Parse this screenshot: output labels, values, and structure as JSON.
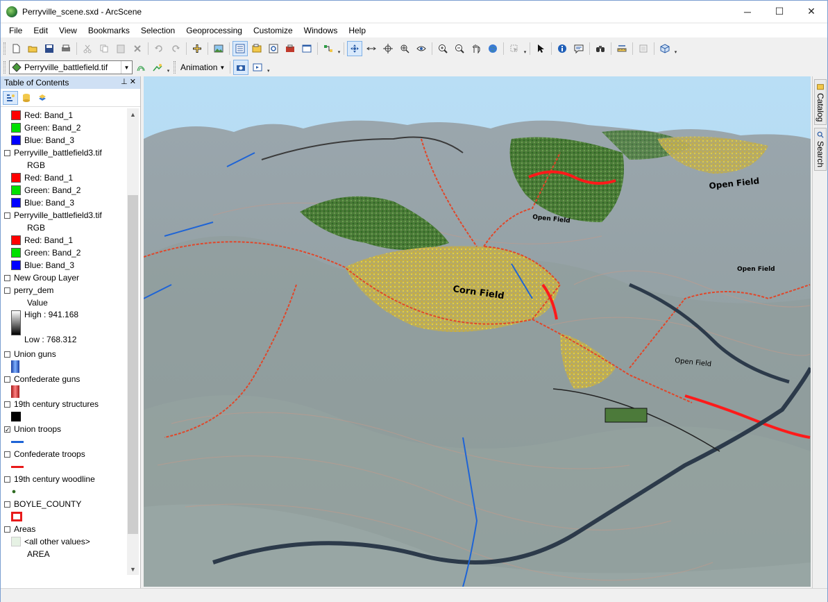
{
  "window": {
    "title": "Perryville_scene.sxd - ArcScene",
    "minimize": "─",
    "maximize": "☐",
    "close": "✕"
  },
  "menu": [
    "File",
    "Edit",
    "View",
    "Bookmarks",
    "Selection",
    "Geoprocessing",
    "Customize",
    "Windows",
    "Help"
  ],
  "toolbar2": {
    "layer_select": "Perryville_battlefield.tif",
    "animation_label": "Animation"
  },
  "toc": {
    "title": "Table of Contents",
    "pin": "⊥ ✕",
    "rows": [
      {
        "kind": "band",
        "color": "#ff0000",
        "text": "Red:    Band_1"
      },
      {
        "kind": "band",
        "color": "#00e000",
        "text": "Green: Band_2"
      },
      {
        "kind": "band",
        "color": "#0000ff",
        "text": "Blue:   Band_3"
      },
      {
        "kind": "layer",
        "checked": false,
        "text": "Perryville_battlefield3.tif"
      },
      {
        "kind": "sub",
        "text": "RGB"
      },
      {
        "kind": "band",
        "color": "#ff0000",
        "text": "Red:    Band_1"
      },
      {
        "kind": "band",
        "color": "#00e000",
        "text": "Green: Band_2"
      },
      {
        "kind": "band",
        "color": "#0000ff",
        "text": "Blue:   Band_3"
      },
      {
        "kind": "layer",
        "checked": false,
        "text": "Perryville_battlefield3.tif"
      },
      {
        "kind": "sub",
        "text": "RGB"
      },
      {
        "kind": "band",
        "color": "#ff0000",
        "text": "Red:    Band_1"
      },
      {
        "kind": "band",
        "color": "#00e000",
        "text": "Green: Band_2"
      },
      {
        "kind": "band",
        "color": "#0000ff",
        "text": "Blue:   Band_3"
      },
      {
        "kind": "layer",
        "checked": false,
        "text": "New Group Layer"
      },
      {
        "kind": "layer",
        "checked": false,
        "text": "perry_dem"
      },
      {
        "kind": "sub",
        "text": "Value"
      }
    ],
    "dem": {
      "high": "High : 941.168",
      "low": "Low : 768.312"
    },
    "layers2": [
      {
        "checked": false,
        "text": "Union guns",
        "legend": "union-guns"
      },
      {
        "checked": false,
        "text": "Confederate guns",
        "legend": "confederate-guns"
      },
      {
        "checked": false,
        "text": "19th century structures",
        "legend": "structures"
      },
      {
        "checked": true,
        "text": "Union troops",
        "legend": "union-troops"
      },
      {
        "checked": false,
        "text": "Confederate troops",
        "legend": "confederate-troops"
      },
      {
        "checked": false,
        "text": "19th century woodline",
        "legend": "woodline"
      },
      {
        "checked": false,
        "text": "BOYLE_COUNTY",
        "legend": "county"
      },
      {
        "checked": false,
        "text": "Areas",
        "legend": "none"
      }
    ],
    "areas_other": "<all other values>",
    "areas_field": "AREA"
  },
  "scene": {
    "labels": [
      "Corn Field",
      "Open Field",
      "Open Field",
      "Open Field",
      "Open Field"
    ]
  },
  "dock": {
    "catalog": "Catalog",
    "search": "Search"
  }
}
